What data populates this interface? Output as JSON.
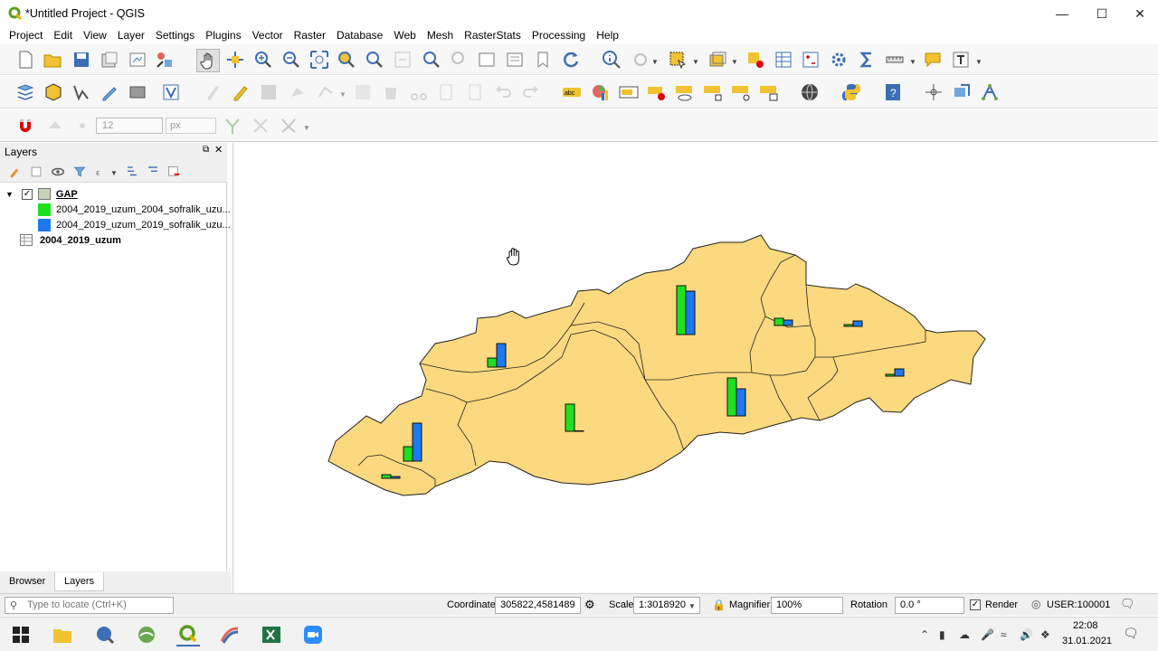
{
  "window": {
    "title": "*Untitled Project - QGIS"
  },
  "menu": [
    "Project",
    "Edit",
    "View",
    "Layer",
    "Settings",
    "Plugins",
    "Vector",
    "Raster",
    "Database",
    "Web",
    "Mesh",
    "RasterStats",
    "Processing",
    "Help"
  ],
  "snapping": {
    "tolerance": "12",
    "unit": "px"
  },
  "layers_panel": {
    "title": "Layers",
    "group": {
      "name": "GAP",
      "checked": true
    },
    "legend": [
      {
        "label": "2004_2019_uzum_2004_sofralik_uzu...",
        "color": "#1fe01f"
      },
      {
        "label": "2004_2019_uzum_2019_sofralik_uzu...",
        "color": "#1e78f0"
      }
    ],
    "table_layer": "2004_2019_uzum"
  },
  "bottom_tabs": {
    "browser": "Browser",
    "layers": "Layers"
  },
  "status": {
    "locator_placeholder": "Type to locate (Ctrl+K)",
    "coordinate_label": "Coordinate",
    "coordinate_value": "305822,4581489",
    "scale_label": "Scale",
    "scale_value": "1:3018920",
    "magnifier_label": "Magnifier",
    "magnifier_value": "100%",
    "rotation_label": "Rotation",
    "rotation_value": "0.0 °",
    "render_label": "Render",
    "crs": "USER:100001"
  },
  "taskbar": {
    "time": "22:08",
    "date": "31.01.2021"
  },
  "map": {
    "fill": "#fbd97e",
    "series_colors": [
      "#1fe01f",
      "#1e78f0"
    ],
    "charts": [
      {
        "name": "chart-1",
        "values": [
          10,
          26
        ]
      },
      {
        "name": "chart-2",
        "values": [
          30,
          0
        ]
      },
      {
        "name": "chart-3",
        "values": [
          54,
          48
        ]
      },
      {
        "name": "chart-4",
        "values": [
          8,
          6
        ]
      },
      {
        "name": "chart-5",
        "values": [
          2,
          6
        ]
      },
      {
        "name": "chart-6",
        "values": [
          42,
          30
        ]
      },
      {
        "name": "chart-7",
        "values": [
          2,
          8
        ]
      },
      {
        "name": "chart-8",
        "values": [
          16,
          42
        ]
      },
      {
        "name": "chart-9",
        "values": [
          4,
          2
        ]
      }
    ]
  }
}
